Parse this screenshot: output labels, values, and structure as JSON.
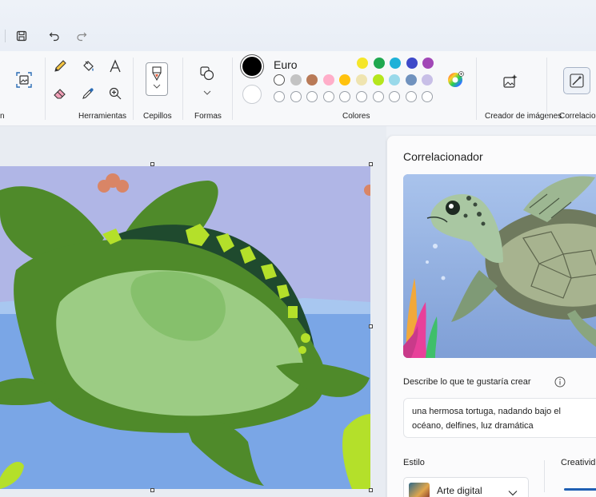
{
  "quick_access": {
    "save_icon": "save-icon",
    "undo_icon": "undo-icon",
    "redo_icon": "redo-icon"
  },
  "ribbon": {
    "groups": {
      "image_partial": "n",
      "tools": "Herramientas",
      "brushes": "Cepillos",
      "shapes": "Formas",
      "colors": "Colores",
      "image_creator": "Creador de imágenes",
      "cocreator_partial": "Correlacio"
    },
    "color_name": "Euro",
    "primary_color": "#000000",
    "secondary_color": "#ffffff",
    "palette_row1": [
      "#f5e62a",
      "#1fa84f",
      "#1fb1d8",
      "#3e49c9",
      "#a147b6"
    ],
    "palette_row2": [
      "#ffffff",
      "#c3c3c3",
      "#b97a57",
      "#ffaec9",
      "#ffc20e",
      "#efe4b0",
      "#b5e61d",
      "#99d9ea",
      "#7092be",
      "#c8bfe7"
    ],
    "palette_row3_empty": 10
  },
  "panel": {
    "title": "Correlacionador",
    "prompt_label": "Describe lo que te gustaría crear",
    "prompt_text": "una hermosa tortuga, nadando bajo el océano, delfines, luz dramática",
    "style_label": "Estilo",
    "style_value": "Arte digital",
    "creativity_label": "Creativid"
  },
  "colors": {
    "canvas_sky": "#b0b6e6",
    "canvas_sea": "#7aa6e6",
    "turtle_dark": "#4f8a2a",
    "turtle_light": "#9ccc84",
    "accent_lime": "#b4e02a"
  }
}
